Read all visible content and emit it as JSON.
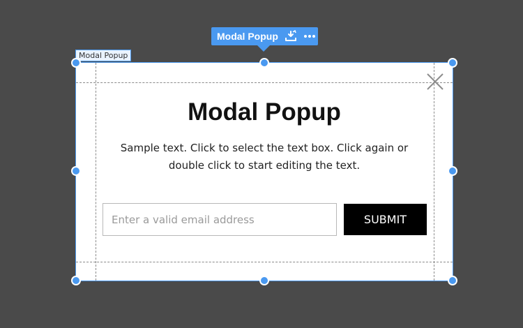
{
  "toolbar": {
    "title": "Modal Popup",
    "icons": [
      "swap-element-icon",
      "more-options-icon"
    ],
    "accent_color": "#4a99f0"
  },
  "element_tag": {
    "label": "Modal Popup"
  },
  "modal": {
    "title": "Modal Popup",
    "text": "Sample text. Click to select the text box. Click again or double click to start editing the text.",
    "email_placeholder": "Enter a valid email address",
    "email_value": "",
    "submit_label": "SUBMIT",
    "close_icon": "close-icon",
    "background_color": "#ffffff",
    "button_color": "#000000"
  },
  "canvas": {
    "background_color": "#4a4a4a"
  }
}
